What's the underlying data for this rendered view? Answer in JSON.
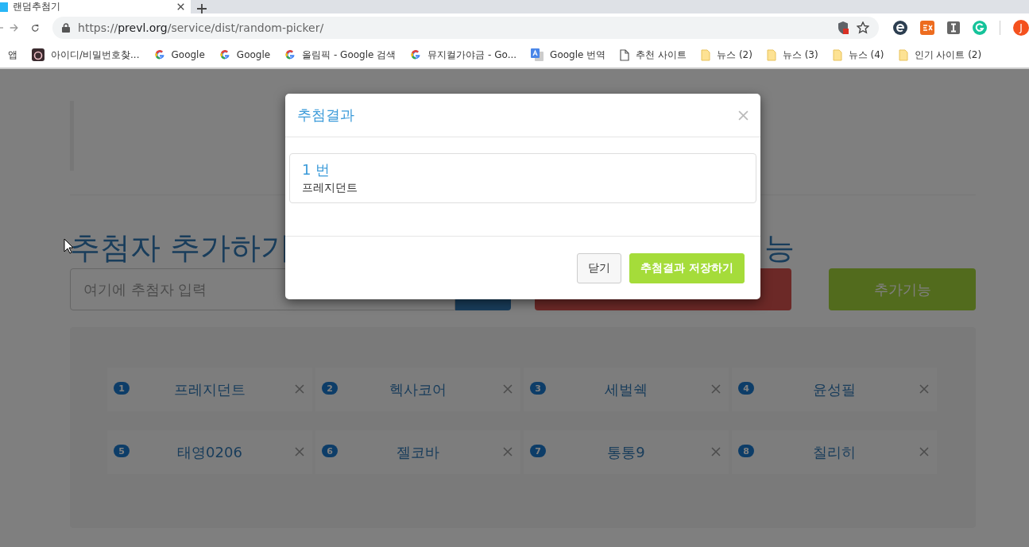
{
  "browser": {
    "tab_title": "랜덤추첨기",
    "url_scheme": "https://",
    "url_host": "prevl.org",
    "url_path": "/service/dist/random-picker/",
    "profile_initial": "J",
    "bookmarks": [
      {
        "kind": "apps",
        "label": "앱"
      },
      {
        "kind": "site",
        "label": "아이디/비밀번호찾..."
      },
      {
        "kind": "google",
        "label": "Google"
      },
      {
        "kind": "google",
        "label": "Google"
      },
      {
        "kind": "google",
        "label": "올림픽 - Google 검색"
      },
      {
        "kind": "google",
        "label": "뮤지컬가야금 - Go..."
      },
      {
        "kind": "translate",
        "label": "Google 번역"
      },
      {
        "kind": "page",
        "label": "추천 사이트"
      },
      {
        "kind": "folder",
        "label": "뉴스 (2)"
      },
      {
        "kind": "folder",
        "label": "뉴스 (3)"
      },
      {
        "kind": "folder",
        "label": "뉴스 (4)"
      },
      {
        "kind": "folder",
        "label": "인기 사이트 (2)"
      }
    ]
  },
  "page": {
    "heading_left": "추첨자 추가하기",
    "heading_right": "능",
    "input": {
      "placeholder": "여기에 추첨자 입력"
    },
    "extra_button": "추가기능",
    "entries": [
      {
        "number": "1",
        "name": "프레지던트"
      },
      {
        "number": "2",
        "name": "헥사코어"
      },
      {
        "number": "3",
        "name": "세벌쉑"
      },
      {
        "number": "4",
        "name": "윤성필"
      },
      {
        "number": "5",
        "name": "태영0206"
      },
      {
        "number": "6",
        "name": "젤코바"
      },
      {
        "number": "7",
        "name": "통통9"
      },
      {
        "number": "8",
        "name": "칠리히"
      }
    ]
  },
  "modal": {
    "title": "추첨결과",
    "result": {
      "number": "1 번",
      "name": "프레지던트"
    },
    "buttons": [
      {
        "kind": "default",
        "label": "닫기"
      },
      {
        "kind": "primary",
        "label": "추첨결과 저장하기"
      }
    ]
  }
}
